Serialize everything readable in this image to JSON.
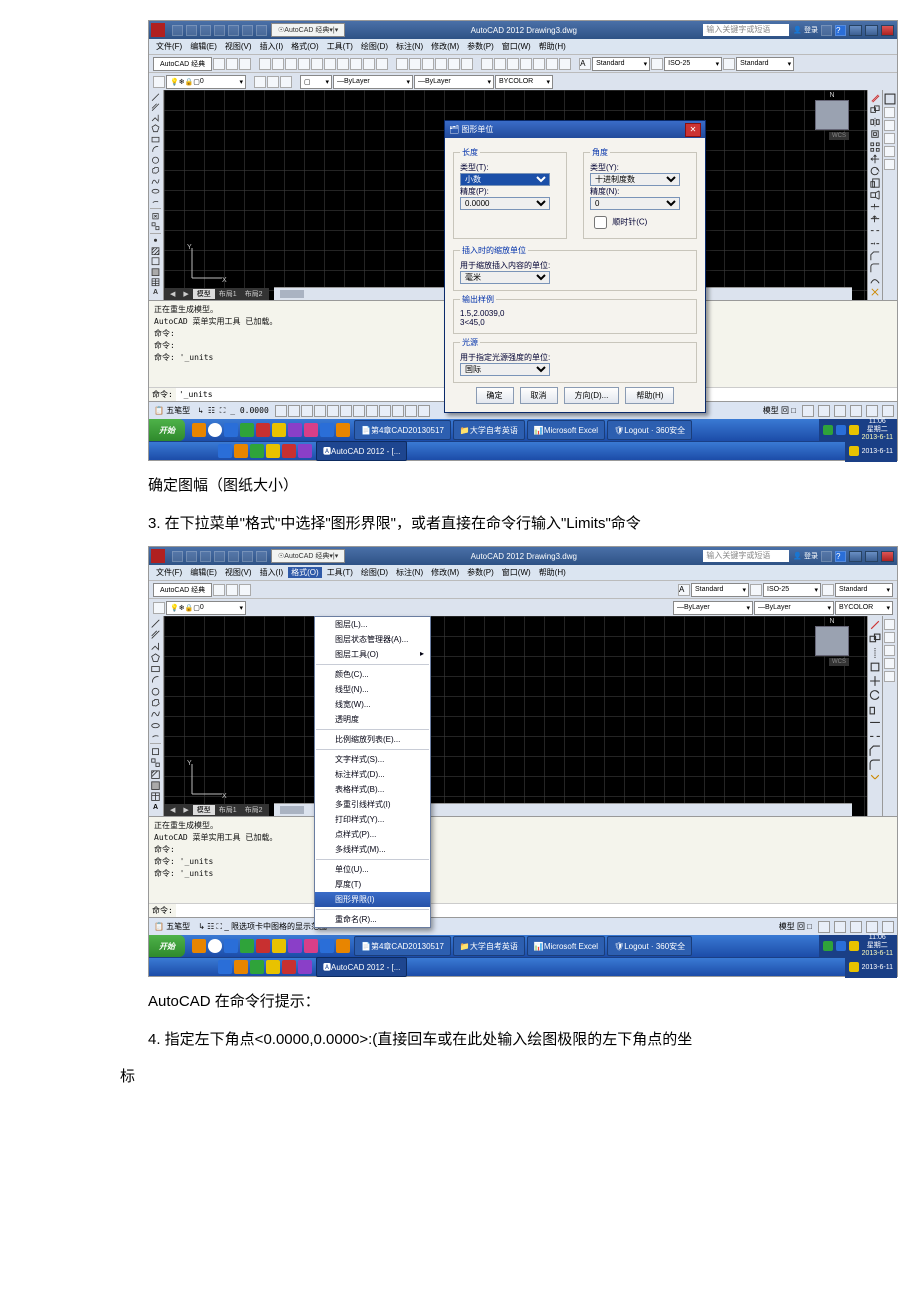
{
  "shot1": {
    "titlebar": {
      "workspace_dd": "AutoCAD 经典",
      "title": "AutoCAD 2012   Drawing3.dwg",
      "search_ph": "输入关键字或短语",
      "login": "登录"
    },
    "menubar": [
      "文件(F)",
      "编辑(E)",
      "视图(V)",
      "插入(I)",
      "格式(O)",
      "工具(T)",
      "绘图(D)",
      "标注(N)",
      "修改(M)",
      "参数(P)",
      "窗口(W)",
      "帮助(H)"
    ],
    "toolbar": {
      "workspace": "AutoCAD 经典",
      "bylayer1": "ByLayer",
      "bylayer2": "ByLayer",
      "bycolor": "BYCOLOR",
      "standard": "Standard",
      "iso": "ISO-25",
      "std2": "Standard"
    },
    "layerbar": {
      "layer": "0"
    },
    "tabs": [
      "◀",
      "▶",
      "模型",
      "布局1",
      "布局2"
    ],
    "wcs": "WCS",
    "cmd_lines": [
      "正在重生成模型。",
      "AutoCAD 菜单实用工具 已加载。",
      "命令:",
      "命令:",
      "命令: '_units"
    ],
    "cmd_prompt": "命令:",
    "cmd_value": "'_units",
    "status": {
      "ime": "五笔型",
      "coord": "➚ ☷",
      "coord2": "0.0000",
      "right": "模型 回 □"
    },
    "dialog": {
      "title": "图形单位",
      "length": "长度",
      "type1": "类型(T):",
      "type1_val": "小数",
      "prec1": "精度(P):",
      "prec1_val": "0.0000",
      "angle": "角度",
      "type2": "类型(Y):",
      "type2_val": "十进制度数",
      "prec2": "精度(N):",
      "prec2_val": "0",
      "cw": "顺时针(C)",
      "insert_t": "插入时的缩放单位",
      "insert_l": "用于缩放插入内容的单位:",
      "insert_val": "毫米",
      "sample_t": "输出样例",
      "sample1": "1.5,2.0039,0",
      "sample2": "3<45,0",
      "light_t": "光源",
      "light_l": "用于指定光源强度的单位:",
      "light_val": "国际",
      "btn_ok": "确定",
      "btn_cancel": "取消",
      "btn_dir": "方向(D)...",
      "btn_help": "帮助(H)"
    },
    "taskbar": {
      "start": "开始",
      "tasks": [
        "第4章CAD20130517",
        "大学自考英语",
        "Microsoft Excel",
        "Logout · 360安全",
        "AutoCAD 2012 - [..."
      ],
      "time": "11:06",
      "day": "星期二",
      "date": "2013-6-11"
    }
  },
  "text_a": "确定图幅（图纸大小）",
  "text_b": "3. 在下拉菜单\"格式\"中选择\"图形界限\"，或者直接在命令行输入\"Limits\"命令",
  "shot2": {
    "titlebar": {
      "workspace_dd": "AutoCAD 经典",
      "title": "AutoCAD 2012   Drawing3.dwg",
      "search_ph": "输入关键字或短语",
      "login": "登录"
    },
    "menubar": [
      "文件(F)",
      "编辑(E)",
      "视图(V)",
      "插入(I)",
      "格式(O)",
      "工具(T)",
      "绘图(D)",
      "标注(N)",
      "修改(M)",
      "参数(P)",
      "窗口(W)",
      "帮助(H)"
    ],
    "toolbar": {
      "workspace": "AutoCAD 经典",
      "bylayer1": "ByLayer",
      "bylayer2": "ByLayer",
      "bycolor": "BYCOLOR",
      "standard": "Standard",
      "iso": "ISO-25",
      "std2": "Standard"
    },
    "layerbar": {
      "layer": "0"
    },
    "tabs": [
      "◀",
      "▶",
      "模型",
      "布局1",
      "布局2"
    ],
    "cmd_lines": [
      "正在重生成模型。",
      "AutoCAD 菜单实用工具 已加载。",
      "命令:",
      "命令: '_units",
      "命令: '_units"
    ],
    "cmd_prompt": "命令:",
    "status": {
      "ime": "五笔型",
      "hint": "限选项卡中图格的显示范围",
      "right": "模型 回 □"
    },
    "format_menu": [
      {
        "l": "图层(L)..."
      },
      {
        "l": "图层状态管理器(A)..."
      },
      {
        "l": "图层工具(O)",
        "sub": true
      },
      {
        "sep": true
      },
      {
        "l": "颜色(C)..."
      },
      {
        "l": "线型(N)..."
      },
      {
        "l": "线宽(W)..."
      },
      {
        "l": "透明度"
      },
      {
        "sep": true
      },
      {
        "l": "比例缩放列表(E)..."
      },
      {
        "sep": true
      },
      {
        "l": "文字样式(S)..."
      },
      {
        "l": "标注样式(D)..."
      },
      {
        "l": "表格样式(B)..."
      },
      {
        "l": "多重引线样式(I)"
      },
      {
        "l": "打印样式(Y)..."
      },
      {
        "l": "点样式(P)..."
      },
      {
        "l": "多线样式(M)..."
      },
      {
        "sep": true
      },
      {
        "l": "单位(U)..."
      },
      {
        "l": "厚度(T)"
      },
      {
        "l": "图形界限(I)",
        "hl": true
      },
      {
        "sep": true
      },
      {
        "l": "重命名(R)..."
      }
    ],
    "taskbar": {
      "start": "开始",
      "tasks": [
        "第4章CAD20130517",
        "大学自考英语",
        "Microsoft Excel",
        "Logout · 360安全",
        "AutoCAD 2012 - [..."
      ],
      "time": "11:06",
      "day": "星期二",
      "date": "2013-6-11"
    }
  },
  "text_c": "AutoCAD 在命令行提示：",
  "text_d": "4. 指定左下角点<0.0000,0.0000>:(直接回车或在此处输入绘图极限的左下角点的坐",
  "text_e": "标"
}
